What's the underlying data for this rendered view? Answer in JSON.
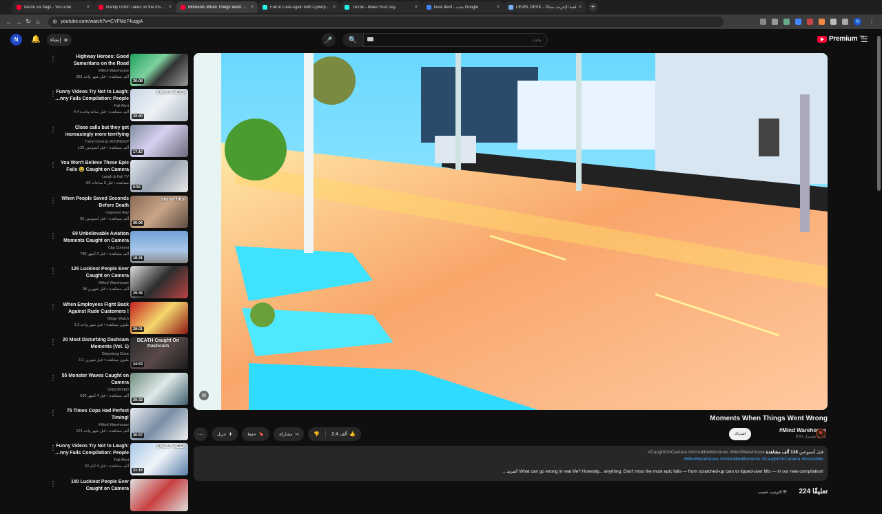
{
  "browser": {
    "tabs": [
      {
        "title": "falcon six flags - YouTube",
        "color": "#ff0033",
        "active": false
      },
      {
        "title": "Randy Orton Takes on the Ins…",
        "color": "#ff0033",
        "active": false
      },
      {
        "title": "Moments When Things Went W…",
        "color": "#ff0033",
        "active": true
      },
      {
        "title": "Fall in Love Again with Cyberp…",
        "color": "#25f4ee",
        "active": false
      },
      {
        "title": "TikTok - Make Your Day",
        "color": "#25f4ee",
        "active": false
      },
      {
        "title": "level devil - بحث Google",
        "color": "#4285f4",
        "active": false
      },
      {
        "title": "LEVEL DEVIL - لعبة الإنترنت مجانًا",
        "color": "#7ab4ff",
        "active": false
      }
    ],
    "url": "youtube.com/watch?v=CYFMz74uqgA",
    "profile_initial": "N"
  },
  "header": {
    "avatar_initial": "N",
    "create_label": "إنشاء",
    "search_placeholder": "بحث",
    "logo_text": "Premium",
    "logo_region": "SA"
  },
  "recommendations": [
    {
      "title": "Highway Heroes: Good Samaritans on the Road",
      "channel": "#Mind Warehouse",
      "stats": "381 ألف مشاهدة • قبل شهر واحد",
      "duration": "30:08",
      "overlay": "",
      "bg": "linear-gradient(135deg,#1fa060,#7fd2a0 40%,#333 60%,#999)"
    },
    {
      "title": "Funny Videos Try Not to Laugh: …nny Fails Compilation: People",
      "channel": "Fail Alert",
      "stats": "4.4 ألف مشاهدة • قبل ساعة واحدة",
      "duration": "32:40",
      "overlay": "FAILS WEEK",
      "bg": "linear-gradient(135deg,#c8d6e6,#eef2f6 50%,#b0b8c4)"
    },
    {
      "title": "Close calls but they get increasingly more terrifying",
      "channel": "Trend Central, ROUNDUP",
      "stats": "130 ألف مشاهدة • قبل أسبوعين",
      "duration": "17:10",
      "overlay": "",
      "bg": "linear-gradient(135deg,#7f8f9f,#d8d0f0 45%,#6a6a7a)"
    },
    {
      "title": "You Won't Believe These Epic Fails 😂 Caught on Camera",
      "channel": "Laugh & Fail TV",
      "stats": "89 مشاهدة • قبل 6 ساعات",
      "duration": "9:56",
      "overlay": "",
      "bg": "linear-gradient(135deg,#dfe6ee,#9aa3b2 50%,#e8e8e8)"
    },
    {
      "title": "When People Saved Seconds Before Death",
      "channel": "Inspector Ray",
      "stats": "93 ألف مشاهدة • قبل أسبوعين",
      "duration": "30:06",
      "overlay": "storm hits!",
      "bg": "linear-gradient(135deg,#8a6a55,#c9a487 50%,#5b4a40)"
    },
    {
      "title": "69 Unbelievable Aviation Moments Caught on Camera",
      "channel": "Clip Context",
      "stats": "780 ألف مشاهدة • قبل 3 أشهر",
      "duration": "18:31",
      "overlay": "",
      "bg": "linear-gradient(180deg,#6fa0d6,#a9c8ea 60%,#8a8a8a)"
    },
    {
      "title": "125 Luckiest People Ever Caught on Camera",
      "channel": "#Mind Warehouse",
      "stats": "98 ألف مشاهدة • قبل شهرين",
      "duration": "29:36",
      "overlay": "",
      "bg": "linear-gradient(135deg,#dcdcdc,#2d2d2d 50%,#b44)"
    },
    {
      "title": "When Employees Fight Back Against Rude Customers !",
      "channel": "Binge Watch",
      "stats": "1.2 مليون مشاهدة • قبل شهر واحد",
      "duration": "28:01",
      "overlay": "",
      "bg": "linear-gradient(135deg,#c41e1e,#f5d76e 50%,#8e1414)"
    },
    {
      "title": "20 Most Disturbing Dashcam Moments (Vol. 1)",
      "channel": "Disturbing Dose",
      "stats": "3.2 مليون مشاهدة • قبل شهرين",
      "duration": "24:53",
      "overlay": "DEATH Caught On Dashcam",
      "bg": "linear-gradient(135deg,#2a2a2a,#5a4a4a 50%,#1a1a1a)"
    },
    {
      "title": "55 Monster Waves Caught on Camera",
      "channel": "UNSORTED",
      "stats": "599 ألف مشاهدة • قبل 4 أشهر",
      "duration": "29:32",
      "overlay": "",
      "bg": "linear-gradient(135deg,#6f8f7f,#dfe8e8 50%,#3f5f6f)"
    },
    {
      "title": "75 Times Cops Had Perfect Timing!",
      "channel": "#Mind Warehouse",
      "stats": "121 ألف مشاهدة • قبل شهر واحد",
      "duration": "30:57",
      "overlay": "",
      "bg": "linear-gradient(135deg,#e8ecf0,#7a8ea6 50%,#f0f0f0)"
    },
    {
      "title": "Funny Videos Try Not to Laugh: …nny Fails Compilation: People",
      "channel": "Fail Alert",
      "stats": "92 ألف مشاهدة • قبل 4 أيام",
      "duration": "31:18",
      "overlay": "FAILS WEEK",
      "bg": "linear-gradient(135deg,#a8c8e8,#f0f4f8 50%,#5a7fa8)"
    },
    {
      "title": "100 Luckiest People Ever Caught on Camera",
      "channel": "",
      "stats": "",
      "duration": "",
      "overlay": "",
      "bg": "linear-gradient(135deg,#e0e0e0,#c84040 50%,#ddd)"
    }
  ],
  "video": {
    "title": "Moments When Things Went Wrong",
    "watermark": "M",
    "like_count": "2.4 ألف",
    "share_label": "مشاركة",
    "save_label": "حفظ",
    "download_label": "تنزيل",
    "channel_name": "#Mind Warehouse",
    "channel_subs": "8.51 مليون مشترك",
    "subscribed_label": "اشتراك",
    "description": {
      "views": "138 ألف مشاهدة",
      "date": "قبل أسبوعين",
      "tags_line1": "#CaughtOnCamera #IncredibleMoments #MindWarehouse",
      "tags_line2": "#MindWarehouse #IncredibleMoments #CaughtOnCamera #Incredible",
      "text": "What can go wrong in real life? Honestly... anything. Don't miss the most epic fails — from scratched-up cars to tipped-over lifts — in our new compilation!",
      "more": "...المزيد"
    },
    "comments_count": "224 تعليقًا",
    "sort_label": "الترتيب حسب"
  },
  "icons": {
    "back": "←",
    "forward": "→",
    "reload": "↻",
    "home": "⌂",
    "bell": "🔔",
    "mic": "🎤",
    "search": "🔍",
    "menu": "☰",
    "more": "⋮",
    "more_h": "⋯",
    "like": "👍",
    "dislike": "👎",
    "share": "↪",
    "save": "🔖",
    "download": "⬇",
    "sort": "☰"
  }
}
